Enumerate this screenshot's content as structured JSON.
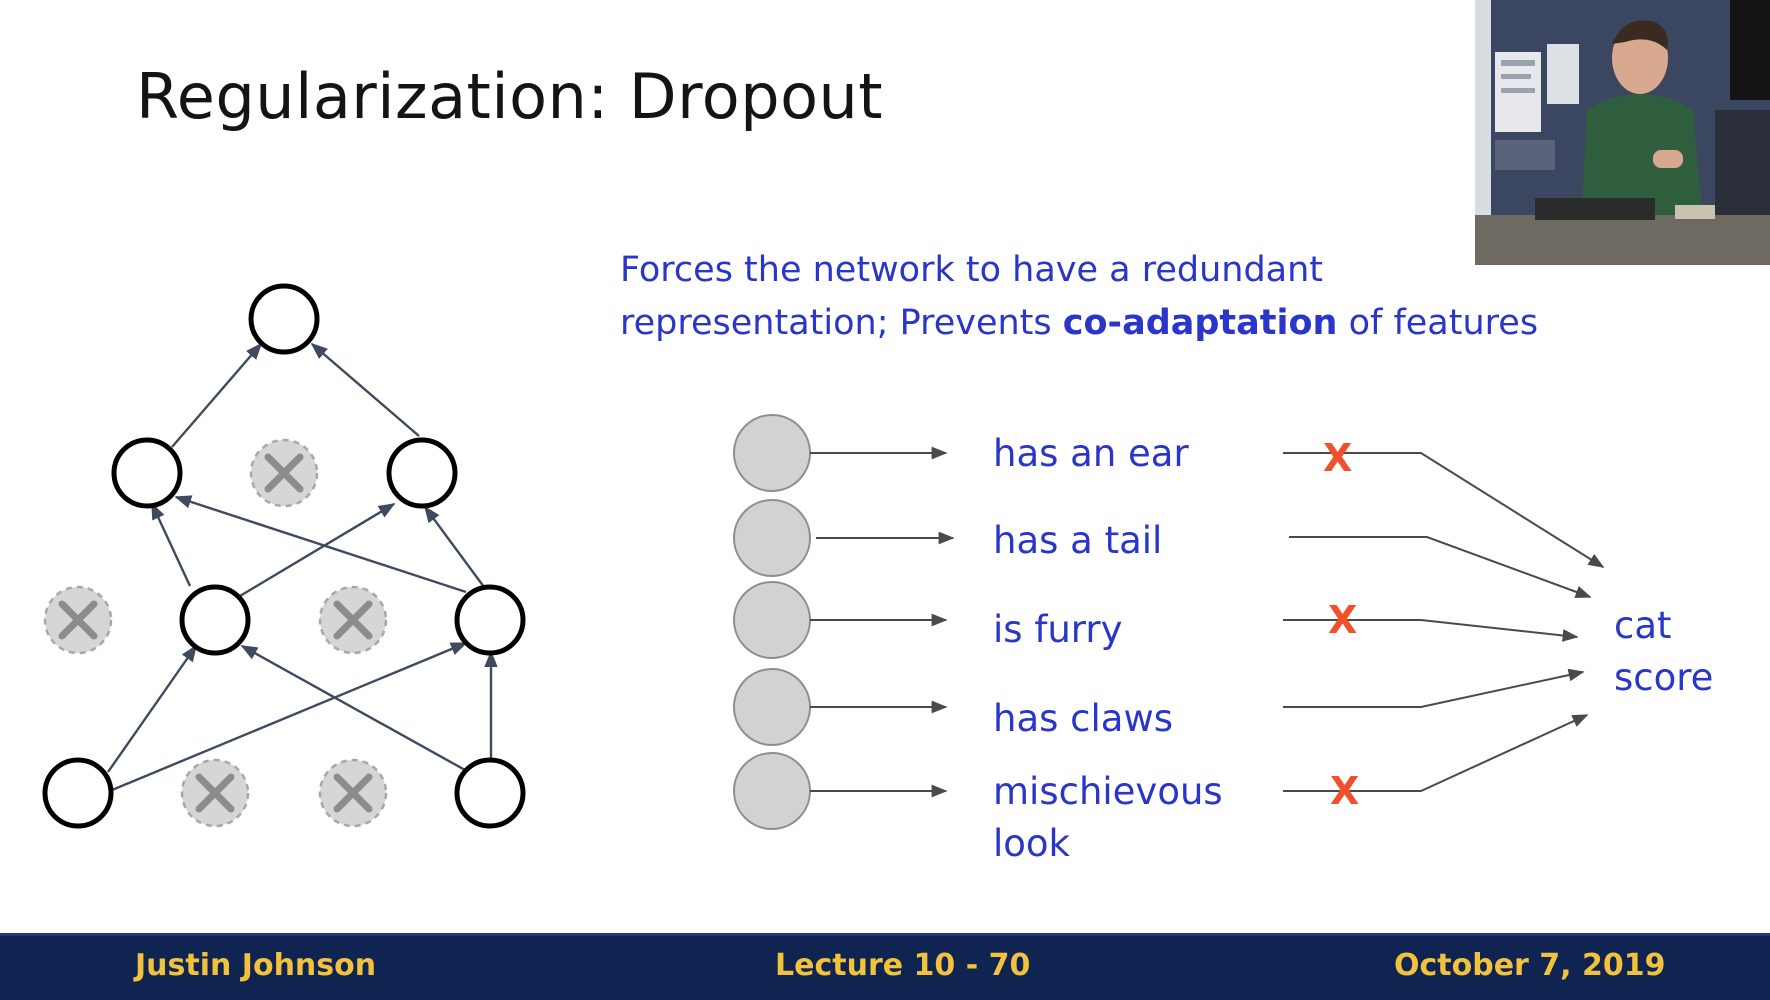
{
  "slide": {
    "title": "Regularization: Dropout",
    "tagline_part1": "Forces the network to have a redundant representation; Prevents ",
    "tagline_bold": "co-adaptation",
    "tagline_part2": " of features",
    "features": [
      {
        "label": "has an ear",
        "dropped": true
      },
      {
        "label": "has a tail",
        "dropped": false
      },
      {
        "label": "is furry",
        "dropped": true
      },
      {
        "label": "has claws",
        "dropped": false
      },
      {
        "label": "mischievous look",
        "dropped": true
      }
    ],
    "drop_mark": "X",
    "output_label": "cat score"
  },
  "footer": {
    "author": "Justin Johnson",
    "lecture": "Lecture 10 - 70",
    "date": "October 7, 2019"
  },
  "colors": {
    "text_blue": "#2a35c9",
    "drop_orange": "#f0502a",
    "footer_bg": "#0f2450",
    "footer_text": "#f3c23c",
    "neuron_gray": "#d0d0d0"
  }
}
